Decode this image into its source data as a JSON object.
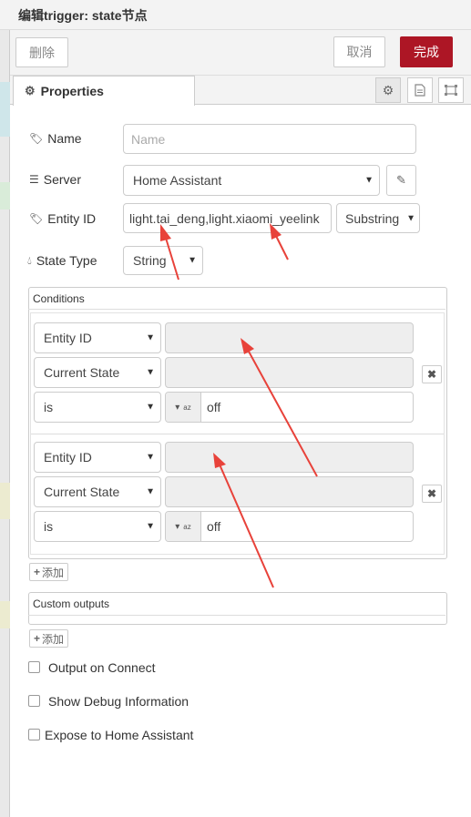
{
  "title": "编辑trigger: state节点",
  "footer": {
    "delete_label": "删除",
    "cancel_label": "取消",
    "done_label": "完成"
  },
  "tabs": {
    "properties_label": "Properties"
  },
  "form": {
    "name": {
      "label": "Name",
      "placeholder": "Name"
    },
    "server": {
      "label": "Server",
      "value": "Home Assistant"
    },
    "entity_id": {
      "label": "Entity ID",
      "value": "light.tai_deng,light.xiaomi_yeelink",
      "match_type": "Substring"
    },
    "state_type": {
      "label": "State Type",
      "value": "String"
    }
  },
  "conditions": {
    "header": "Conditions",
    "items": [
      {
        "type": "Entity ID",
        "value": "",
        "property": "Current State",
        "property_value": "",
        "operator": "is",
        "compare_value": "off"
      },
      {
        "type": "Entity ID",
        "value": "",
        "property": "Current State",
        "property_value": "",
        "operator": "is",
        "compare_value": "off"
      }
    ],
    "add_label": "添加"
  },
  "custom_outputs": {
    "header": "Custom outputs",
    "add_label": "添加"
  },
  "options": [
    {
      "label": "Output on Connect"
    },
    {
      "label": "Show Debug Information"
    },
    {
      "label": "Expose to Home Assistant"
    }
  ],
  "colors": {
    "accent": "#ad1625",
    "annotation_arrow": "#e8423a"
  }
}
